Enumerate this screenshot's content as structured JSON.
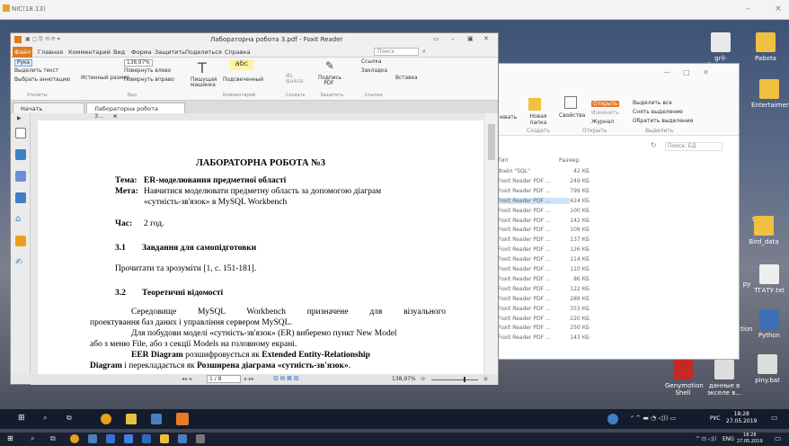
{
  "outer_window": {
    "title": "NIC(18.13)"
  },
  "desktop_icons": [
    {
      "label": "gril-flappy-..."
    },
    {
      "label": "Pabota"
    },
    {
      "label": "Entertaiment"
    },
    {
      "label": "txt"
    },
    {
      "label": "Bird_data"
    },
    {
      "label": "ру"
    },
    {
      "label": "ТГАТУ.txt"
    },
    {
      "label": "ction"
    },
    {
      "label": "Python"
    },
    {
      "label": "Genymotion Shell"
    },
    {
      "label": "данные в экселе в..."
    },
    {
      "label": "piny.bat"
    }
  ],
  "explorer": {
    "ribbon": {
      "copy_label": "ювать",
      "new_folder_label": "Новая папка",
      "properties_label": "Свойства",
      "open_label": "Открыть",
      "edit_label": "Изменить",
      "journal_label": "Журнал",
      "select_all": "Выделить все",
      "deselect": "Снять выделение",
      "invert": "Обратить выделение",
      "group_create": "Создать",
      "group_open": "Открыть",
      "group_select": "Выделить"
    },
    "search_placeholder": "Поиск: БД",
    "columns": {
      "type": "Тип",
      "size": "Размер"
    },
    "files": [
      {
        "type": "Файл \"SQL\"",
        "size": "42 КБ",
        "selected": false
      },
      {
        "type": "Foxit Reader PDF ...",
        "size": "249 КБ",
        "selected": false
      },
      {
        "type": "Foxit Reader PDF ...",
        "size": "799 КБ",
        "selected": false
      },
      {
        "type": "Foxit Reader PDF ...",
        "size": "424 КБ",
        "selected": true
      },
      {
        "type": "Foxit Reader PDF ...",
        "size": "100 КБ",
        "selected": false
      },
      {
        "type": "Foxit Reader PDF ...",
        "size": "142 КБ",
        "selected": false
      },
      {
        "type": "Foxit Reader PDF ...",
        "size": "109 КБ",
        "selected": false
      },
      {
        "type": "Foxit Reader PDF ...",
        "size": "137 КБ",
        "selected": false
      },
      {
        "type": "Foxit Reader PDF ...",
        "size": "126 КБ",
        "selected": false
      },
      {
        "type": "Foxit Reader PDF ...",
        "size": "114 КБ",
        "selected": false
      },
      {
        "type": "Foxit Reader PDF ...",
        "size": "110 КБ",
        "selected": false
      },
      {
        "type": "Foxit Reader PDF ...",
        "size": "86 КБ",
        "selected": false
      },
      {
        "type": "Foxit Reader PDF ...",
        "size": "122 КБ",
        "selected": false
      },
      {
        "type": "Foxit Reader PDF ...",
        "size": "289 КБ",
        "selected": false
      },
      {
        "type": "Foxit Reader PDF ...",
        "size": "353 КБ",
        "selected": false
      },
      {
        "type": "Foxit Reader PDF ...",
        "size": "220 КБ",
        "selected": false
      },
      {
        "type": "Foxit Reader PDF ...",
        "size": "250 КБ",
        "selected": false
      },
      {
        "type": "Foxit Reader PDF ...",
        "size": "143 КБ",
        "selected": false
      }
    ]
  },
  "foxit": {
    "title": "Лабораторна робота 3.pdf - Foxit Reader",
    "file_tab": "Файл",
    "menu": [
      "Главная",
      "Комментарий",
      "Вид",
      "Форма",
      "Защитить",
      "Поделиться",
      "Справка"
    ],
    "search_placeholder": "Поиск",
    "ribbon": {
      "hand": "Рука",
      "select_text": "Выделить текст",
      "select_annot": "Выбрать аннотацию",
      "actual_size": "Истинный размер",
      "zoom": "138,97%",
      "rotate_left": "Повернуть влево",
      "rotate_right": "Повернуть вправо",
      "typewriter": "Пишущая машинка",
      "highlight": "Подсвеченный",
      "from_file": "Из файла",
      "sign_pdf": "Подпись PDF",
      "link": "Ссылка",
      "bookmark": "Закладка",
      "insert": "Вставка",
      "group_tools": "Утилиты",
      "group_view": "Вид",
      "group_comment": "Комментарий",
      "group_create": "Создать",
      "group_protect": "Защитить",
      "group_links": "Ссылки"
    },
    "tabs": [
      "Начать",
      "Лабораторна робота 3..."
    ],
    "status": {
      "page": "1 / 8",
      "zoom": "138,97%"
    }
  },
  "document": {
    "title": "ЛАБОРАТОРНА РОБОТА №3",
    "topic_label": "Тема:",
    "topic_text": "ER-моделювання предметної області",
    "goal_label": "Мета:",
    "goal_text_1": "Навчитися моделювати предметну область за допомогою діаграм",
    "goal_text_2": "«сутність-зв'язок» в MySQL Workbench",
    "time_label": "Час:",
    "time_text": "2 год.",
    "s31_num": "3.1",
    "s31_title": "Завдання для самопідготовки",
    "s31_text": "Прочитати та зрозуміти [1, с. 151-181].",
    "s32_num": "3.2",
    "s32_title": "Теоретичні відомості",
    "p1_l1": "Середовище MySQL Workbench призначене для візуального",
    "p1_l2": "проектування баз даних і управління сервером MySQL.",
    "p2_l1": "Для побудови моделі «сутність-зв'язок» (ER) виберемо пункт New Model",
    "p2_l2": "або з меню File, або з секції Models на головному екрані.",
    "p3_b1": "EER Diagram",
    "p3_t1": " розшифровується як ",
    "p3_b2": "Extended Entity-Relationship",
    "p3_b3": "Diagram",
    "p3_t2": " і перекладається як ",
    "p3_b4": "Розширена діаграма «сутність-зв'язок»",
    "p3_t3": "."
  },
  "taskbar": {
    "lang": "РУС",
    "time": "18:28",
    "date": "27.05.2019"
  },
  "taskbar2": {
    "lang": "ENG",
    "time": "18:28",
    "date": "27.05.2019"
  }
}
